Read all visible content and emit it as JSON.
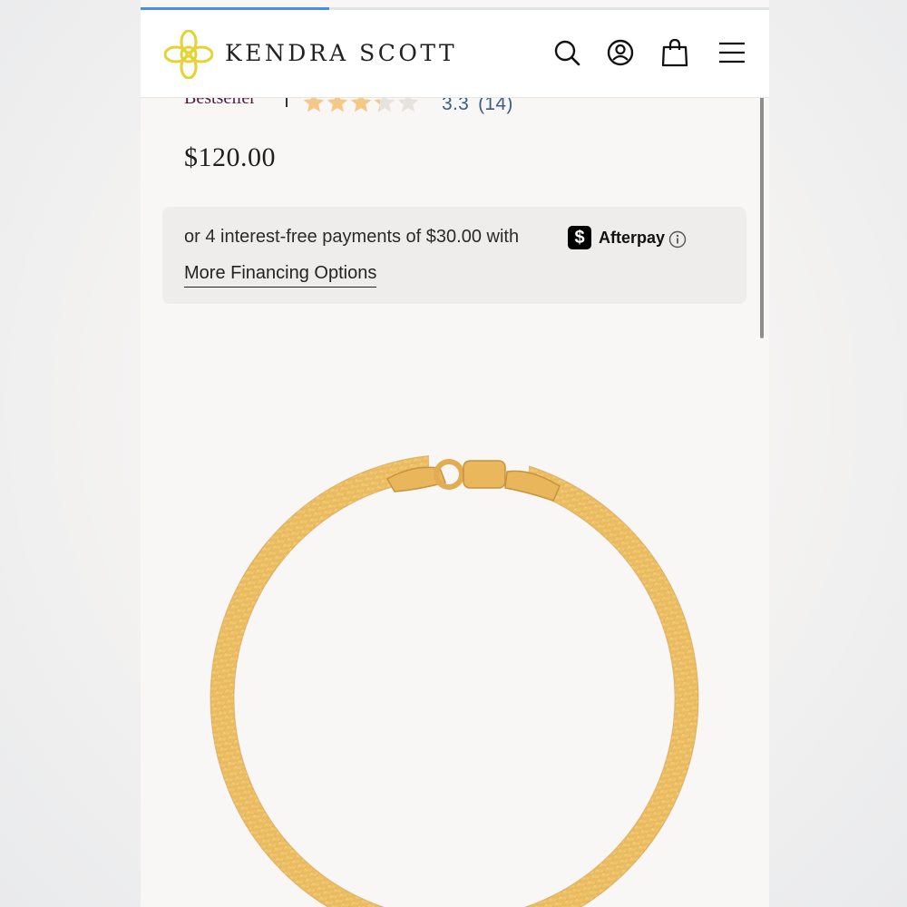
{
  "progress": {
    "fraction": 0.3
  },
  "header": {
    "brand": "KENDRA SCOTT",
    "icons": [
      "search-icon",
      "account-icon",
      "bag-icon",
      "menu-icon"
    ]
  },
  "product": {
    "badge": "Bestseller",
    "rating_value": "3.3",
    "review_count": "(14)",
    "stars_filled": 3.3,
    "price": "$120.00"
  },
  "financing": {
    "text": "or 4 interest-free payments of $30.00 with",
    "provider_icon": "$",
    "provider": "Afterpay",
    "more_link": "More Financing Options"
  },
  "colors": {
    "brand_gold": "#e5d233",
    "star": "#f6c888",
    "star_empty": "#e6e2dd",
    "rating_text": "#3d5f7f",
    "progress": "#4a8fdc"
  }
}
